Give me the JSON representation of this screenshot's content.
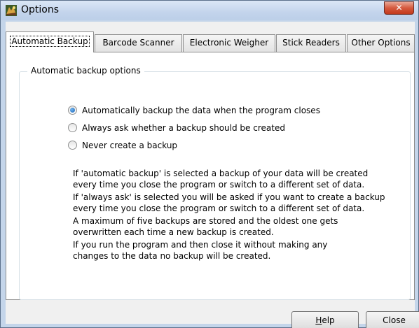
{
  "window": {
    "title": "Options",
    "close_glyph": "✕",
    "icon": "options-app-icon"
  },
  "tabs": [
    {
      "label": "Automatic Backup",
      "active": true
    },
    {
      "label": "Barcode Scanner",
      "active": false
    },
    {
      "label": "Electronic Weigher",
      "active": false
    },
    {
      "label": "Stick Readers",
      "active": false
    },
    {
      "label": "Other Options",
      "active": false
    }
  ],
  "backup": {
    "group_title": "Automatic backup options",
    "options": [
      {
        "label": "Automatically backup the data when the program closes",
        "checked": true
      },
      {
        "label": "Always ask whether a backup should be created",
        "checked": false
      },
      {
        "label": "Never create a backup",
        "checked": false
      }
    ],
    "paragraphs": [
      [
        "If 'automatic backup' is selected a backup of your data will be created",
        "every time you close the program or switch to a different set of data."
      ],
      [
        "If 'always ask' is selected you will be asked if you want to create a backup",
        "every time you close the program or switch to a different set of data."
      ],
      [
        "A maximum of five backups are stored and the oldest one gets",
        "overwritten each time a new backup is created."
      ],
      [
        "If you run the program and then close it without making any",
        "changes to the data no backup will be created."
      ]
    ]
  },
  "buttons": {
    "help_mnemonic": "H",
    "help_rest": "elp",
    "close": "Close"
  },
  "colors": {
    "title_bar": "#c3d4ec",
    "close_button": "#c2391c",
    "radio_selected": "#1b62b5"
  }
}
